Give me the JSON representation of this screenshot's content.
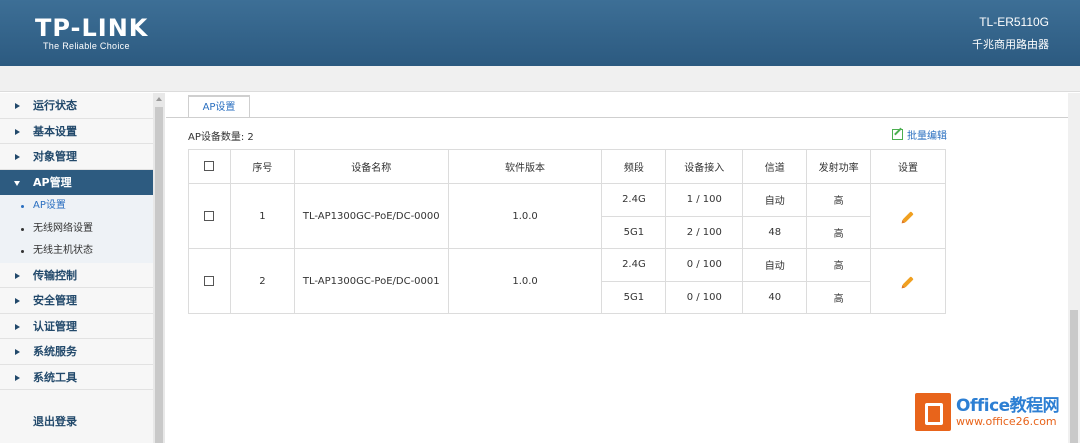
{
  "header": {
    "logo_main": "TP-LINK",
    "logo_sub": "The Reliable Choice",
    "model": "TL-ER5110G",
    "model_desc": "千兆商用路由器"
  },
  "sidebar": {
    "items": [
      {
        "label": "运行状态"
      },
      {
        "label": "基本设置"
      },
      {
        "label": "对象管理"
      },
      {
        "label": "AP管理"
      },
      {
        "label": "传输控制"
      },
      {
        "label": "安全管理"
      },
      {
        "label": "认证管理"
      },
      {
        "label": "系统服务"
      },
      {
        "label": "系统工具"
      }
    ],
    "sub_items": [
      {
        "label": "AP设置"
      },
      {
        "label": "无线网络设置"
      },
      {
        "label": "无线主机状态"
      }
    ],
    "logout": "退出登录"
  },
  "main": {
    "tab": "AP设置",
    "count_label": "AP设备数量: 2",
    "batch_edit": "批量编辑",
    "columns": [
      "序号",
      "设备名称",
      "软件版本",
      "频段",
      "设备接入",
      "信道",
      "发射功率",
      "设置"
    ],
    "rows": [
      {
        "index": "1",
        "name": "TL-AP1300GC-PoE/DC-0000",
        "version": "1.0.0",
        "bands": [
          {
            "band": "2.4G",
            "access": "1 / 100",
            "channel": "自动",
            "power": "高"
          },
          {
            "band": "5G1",
            "access": "2 / 100",
            "channel": "48",
            "power": "高"
          }
        ]
      },
      {
        "index": "2",
        "name": "TL-AP1300GC-PoE/DC-0001",
        "version": "1.0.0",
        "bands": [
          {
            "band": "2.4G",
            "access": "0 / 100",
            "channel": "自动",
            "power": "高"
          },
          {
            "band": "5G1",
            "access": "0 / 100",
            "channel": "40",
            "power": "高"
          }
        ]
      }
    ]
  },
  "watermark": {
    "title": "Office教程网",
    "url": "www.office26.com"
  }
}
